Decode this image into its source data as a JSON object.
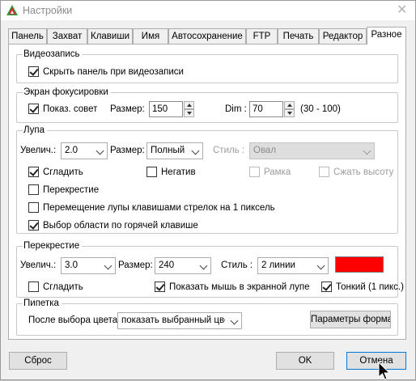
{
  "window": {
    "title": "Настройки",
    "close_glyph": "✕"
  },
  "tabs": [
    {
      "label": "Панель"
    },
    {
      "label": "Захват"
    },
    {
      "label": "Клавиши"
    },
    {
      "label": "Имя"
    },
    {
      "label": "Автосохранение"
    },
    {
      "label": "FTP"
    },
    {
      "label": "Печать"
    },
    {
      "label": "Редактор"
    },
    {
      "label": "Разное",
      "active": true
    }
  ],
  "video": {
    "title": "Видеозапись",
    "hide_panel": {
      "label": "Скрыть панель при видеозаписи",
      "checked": true
    }
  },
  "focus": {
    "title": "Экран фокусировки",
    "show_tip": {
      "label": "Показ. совет",
      "checked": true
    },
    "size_label": "Размер:",
    "size_value": "150",
    "dim_label": "Dim :",
    "dim_value": "70",
    "range_hint": "(30 - 100)"
  },
  "magnifier": {
    "title": "Лупа",
    "zoom_label": "Увелич.:",
    "zoom_value": "2.0",
    "size_label": "Размер:",
    "size_value": "Полный",
    "style_label": "Стиль :",
    "style_value": "Овал",
    "smooth": {
      "label": "Сгладить",
      "checked": true
    },
    "negative": {
      "label": "Негатив",
      "checked": false
    },
    "frame": {
      "label": "Рамка",
      "checked": false
    },
    "compress": {
      "label": "Сжать высоту",
      "checked": false
    },
    "crosshair": {
      "label": "Перекрестие",
      "checked": false
    },
    "arrow_move": {
      "label": "Перемещение лупы клавишами стрелок на 1 пиксель",
      "checked": false
    },
    "hotkey_area": {
      "label": "Выбор области по горячей клавише",
      "checked": true
    }
  },
  "crosshair": {
    "title": "Перекрестие",
    "zoom_label": "Увелич.:",
    "zoom_value": "3.0",
    "size_label": "Размер:",
    "size_value": "240",
    "style_label": "Стиль :",
    "style_value": "2 линии",
    "color": "#ff0000",
    "smooth": {
      "label": "Сгладить",
      "checked": false
    },
    "show_mouse": {
      "label": "Показать мышь в экранной лупе",
      "checked": true
    },
    "thin": {
      "label": "Тонкий (1 пикс.)",
      "checked": true
    }
  },
  "picker": {
    "title": "Пипетка",
    "after_label": "После выбора цвета:",
    "after_value": "показать выбранный цвет",
    "format_button": "Параметры формата"
  },
  "footer": {
    "reset": "Сброс",
    "ok": "OK",
    "cancel": "Отмена"
  }
}
